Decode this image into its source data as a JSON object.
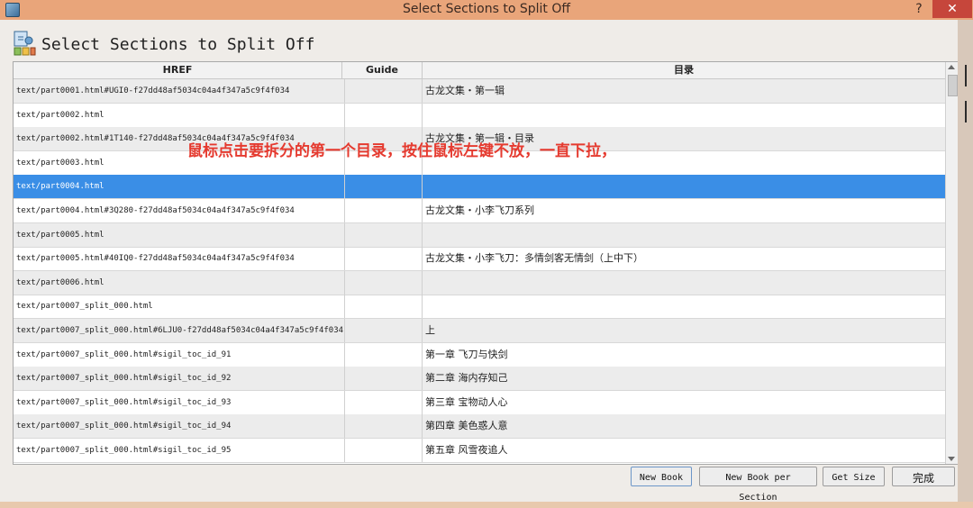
{
  "window": {
    "title": "Select Sections to Split Off",
    "help_label": "?",
    "close_label": "✕"
  },
  "dialog": {
    "heading": "Select Sections to Split Off",
    "icon": "split-sections-icon"
  },
  "table": {
    "columns": [
      "HREF",
      "Guide",
      "目录"
    ],
    "selected_index": 4,
    "rows": [
      {
        "href": "text/part0001.html#UGI0-f27dd48af5034c04a4f347a5c9f4f034",
        "guide": "",
        "toc": "古龙文集・第一辑"
      },
      {
        "href": "text/part0002.html",
        "guide": "",
        "toc": ""
      },
      {
        "href": "text/part0002.html#1T140-f27dd48af5034c04a4f347a5c9f4f034",
        "guide": "",
        "toc": "古龙文集・第一辑・目录"
      },
      {
        "href": "text/part0003.html",
        "guide": "",
        "toc": ""
      },
      {
        "href": "text/part0004.html",
        "guide": "",
        "toc": ""
      },
      {
        "href": "text/part0004.html#3Q280-f27dd48af5034c04a4f347a5c9f4f034",
        "guide": "",
        "toc": "古龙文集・小李飞刀系列"
      },
      {
        "href": "text/part0005.html",
        "guide": "",
        "toc": ""
      },
      {
        "href": "text/part0005.html#40IQ0-f27dd48af5034c04a4f347a5c9f4f034",
        "guide": "",
        "toc": "古龙文集・小李飞刀：多情剑客无情剑（上中下）"
      },
      {
        "href": "text/part0006.html",
        "guide": "",
        "toc": ""
      },
      {
        "href": "text/part0007_split_000.html",
        "guide": "",
        "toc": ""
      },
      {
        "href": "text/part0007_split_000.html#6LJU0-f27dd48af5034c04a4f347a5c9f4f034",
        "guide": "",
        "toc": "上"
      },
      {
        "href": "text/part0007_split_000.html#sigil_toc_id_91",
        "guide": "",
        "toc": "第一章 飞刀与快剑"
      },
      {
        "href": "text/part0007_split_000.html#sigil_toc_id_92",
        "guide": "",
        "toc": "第二章 海内存知己"
      },
      {
        "href": "text/part0007_split_000.html#sigil_toc_id_93",
        "guide": "",
        "toc": "第三章 宝物动人心"
      },
      {
        "href": "text/part0007_split_000.html#sigil_toc_id_94",
        "guide": "",
        "toc": "第四章 美色惑人意"
      },
      {
        "href": "text/part0007_split_000.html#sigil_toc_id_95",
        "guide": "",
        "toc": "第五章 风雪夜追人"
      }
    ]
  },
  "annotation": "鼠标点击要拆分的第一个目录，按住鼠标左键不放，一直下拉，",
  "buttons": {
    "new_book": "New Book",
    "new_book_per_section": "New Book per Section",
    "get_size": "Get Size",
    "done": "完成"
  },
  "colors": {
    "titlebar": "#e9a57a",
    "selection": "#3a8ee6",
    "annotation": "#e53a2f",
    "close_button": "#c6463b"
  }
}
